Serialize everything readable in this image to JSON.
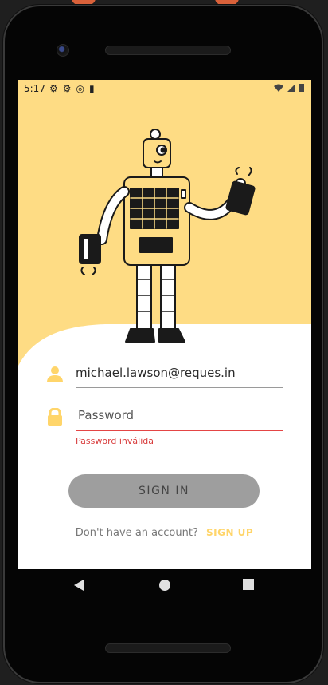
{
  "status_bar": {
    "time": "5:17"
  },
  "login": {
    "email_value": "michael.lawson@reques.in",
    "password_placeholder": "Password",
    "password_value": "",
    "password_error": "Password inválida",
    "signin_label": "SIGN IN",
    "footer_text": "Don't have an account?",
    "signup_label": "SIGN UP"
  },
  "colors": {
    "accent_yellow": "#FEDC84",
    "link_yellow": "#FFD56A",
    "error_red": "#E44545",
    "button_disabled": "#9E9E9E"
  },
  "icons": {
    "user": "user-icon",
    "lock": "lock-icon",
    "back": "back-icon",
    "home": "home-icon",
    "recents": "recents-icon"
  }
}
